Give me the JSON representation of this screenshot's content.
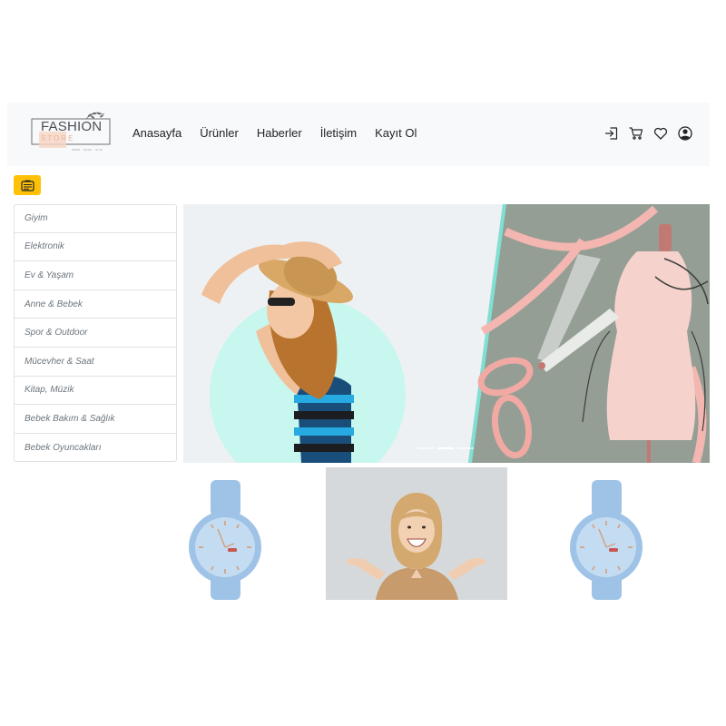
{
  "brand": {
    "name": "FASHION",
    "sub": "STORE",
    "tagline": "WWW · SHOP · SITE"
  },
  "nav": {
    "links": [
      "Anasayfa",
      "Ürünler",
      "Haberler",
      "İletişim",
      "Kayıt Ol"
    ],
    "icons": [
      "login-icon",
      "cart-icon",
      "heart-icon",
      "user-circle-icon"
    ]
  },
  "category_toggle": {
    "icon": "card-icon",
    "color": "#ffc107"
  },
  "categories": [
    "Giyim",
    "Elektronik",
    "Ev & Yaşam",
    "Anne & Bebek",
    "Spor & Outdoor",
    "Mücevher & Saat",
    "Kitap, Müzik",
    "Bebek Bakım & Sağlık",
    "Bebek Oyuncakları"
  ],
  "slider": {
    "indicators": 3,
    "active_index": 1
  },
  "products": [
    {
      "icon": "blue-watch-image"
    },
    {
      "icon": "smiling-woman-image"
    },
    {
      "icon": "blue-watch-image"
    }
  ],
  "colors": {
    "navbar_bg": "#f8f9fa",
    "accent": "#ffc107",
    "watch_blue": "#9fc3e6",
    "hero_green": "#949e95",
    "mint": "#c8f7ef"
  }
}
